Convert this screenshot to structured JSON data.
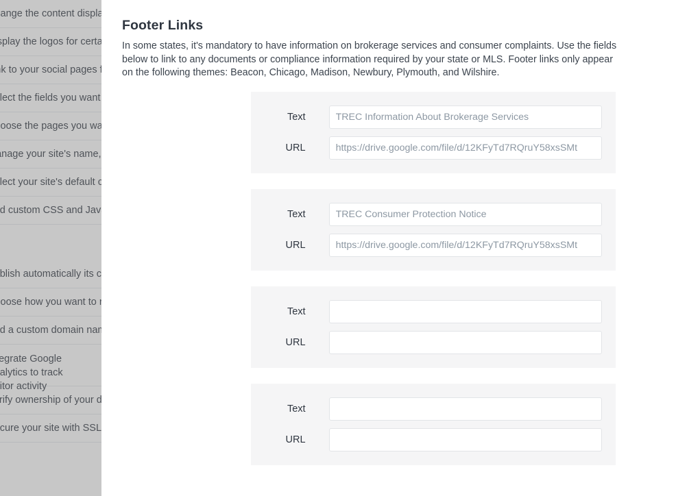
{
  "background_list": {
    "items": [
      {
        "text": "Change the content displayed on your site's home page",
        "tall": false
      },
      {
        "text": "Display the logos for certain partners or affiliations",
        "tall": false
      },
      {
        "text": "Link to your social pages from your site",
        "tall": false
      },
      {
        "text": "Select the fields you want to show on listings",
        "tall": false
      },
      {
        "text": "Choose the pages you want in your site's navigation",
        "tall": false
      },
      {
        "text": "Manage your site's name, logo, and contact details",
        "tall": false
      },
      {
        "text": "Select your site's default colors and fonts",
        "tall": false
      },
      {
        "text": "Add custom CSS and JavaScript to your site",
        "tall": false
      },
      {
        "text": "Publish automatically its content changes",
        "tall": false
      },
      {
        "text": "Choose how you want to receive leads",
        "tall": false
      },
      {
        "text": "Add a custom domain name to your site",
        "tall": false
      },
      {
        "text": "Integrate Google Analytics to track visitor activity",
        "tall": true
      },
      {
        "text": "Verify ownership of your domain name",
        "tall": false
      },
      {
        "text": "Secure your site with SSL encryption",
        "tall": false
      }
    ]
  },
  "modal": {
    "title": "Footer Links",
    "description": "In some states, it's mandatory to have information on brokerage services and consumer complaints. Use the fields below to link to any documents or compliance information required by your state or MLS. Footer links only appear on the following themes: Beacon, Chicago, Madison, Newbury, Plymouth, and Wilshire.",
    "labels": {
      "text": "Text",
      "url": "URL"
    },
    "cards": [
      {
        "text_value": "",
        "text_placeholder": "TREC Information About Brokerage Services",
        "url_value": "",
        "url_placeholder": "https://drive.google.com/file/d/12KFyTd7RQruY58xsSMt"
      },
      {
        "text_value": "",
        "text_placeholder": "TREC Consumer Protection Notice",
        "url_value": "",
        "url_placeholder": "https://drive.google.com/file/d/12KFyTd7RQruY58xsSMt"
      },
      {
        "text_value": "",
        "text_placeholder": "",
        "url_value": "",
        "url_placeholder": ""
      },
      {
        "text_value": "",
        "text_placeholder": "",
        "url_value": "",
        "url_placeholder": ""
      }
    ]
  },
  "colors": {
    "card_background": "#f5f5f6",
    "panel_background": "#ffffff",
    "title_text": "#2f3640",
    "body_text": "#3c444e",
    "placeholder_text": "#8d98a3",
    "input_border": "#e2e4e7",
    "dim_overlay": "rgba(122,122,122,0.42)"
  }
}
